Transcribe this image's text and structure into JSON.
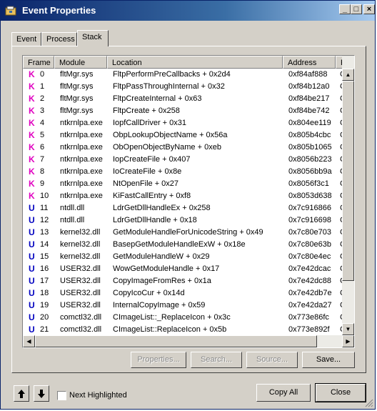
{
  "window": {
    "title": "Event Properties"
  },
  "tabs": [
    {
      "label": "Event",
      "active": false
    },
    {
      "label": "Process",
      "active": false
    },
    {
      "label": "Stack",
      "active": true
    }
  ],
  "columns": [
    "Frame",
    "Module",
    "Location",
    "Address",
    "P"
  ],
  "rows": [
    {
      "type": "K",
      "frame": "0",
      "module": "fltMgr.sys",
      "location": "FltpPerformPreCallbacks + 0x2d4",
      "address": "0xf84af888",
      "path": "C"
    },
    {
      "type": "K",
      "frame": "1",
      "module": "fltMgr.sys",
      "location": "FltpPassThroughInternal + 0x32",
      "address": "0xf84b12a0",
      "path": "C"
    },
    {
      "type": "K",
      "frame": "2",
      "module": "fltMgr.sys",
      "location": "FltpCreateInternal + 0x63",
      "address": "0xf84be217",
      "path": "C"
    },
    {
      "type": "K",
      "frame": "3",
      "module": "fltMgr.sys",
      "location": "FltpCreate + 0x258",
      "address": "0xf84be742",
      "path": "C"
    },
    {
      "type": "K",
      "frame": "4",
      "module": "ntkrnlpa.exe",
      "location": "IopfCallDriver + 0x31",
      "address": "0x804ee119",
      "path": "C"
    },
    {
      "type": "K",
      "frame": "5",
      "module": "ntkrnlpa.exe",
      "location": "ObpLookupObjectName + 0x56a",
      "address": "0x805b4cbc",
      "path": "C"
    },
    {
      "type": "K",
      "frame": "6",
      "module": "ntkrnlpa.exe",
      "location": "ObOpenObjectByName + 0xeb",
      "address": "0x805b1065",
      "path": "C"
    },
    {
      "type": "K",
      "frame": "7",
      "module": "ntkrnlpa.exe",
      "location": "IopCreateFile + 0x407",
      "address": "0x8056b223",
      "path": "C"
    },
    {
      "type": "K",
      "frame": "8",
      "module": "ntkrnlpa.exe",
      "location": "IoCreateFile + 0x8e",
      "address": "0x8056bb9a",
      "path": "C"
    },
    {
      "type": "K",
      "frame": "9",
      "module": "ntkrnlpa.exe",
      "location": "NtOpenFile + 0x27",
      "address": "0x8056f3c1",
      "path": "C"
    },
    {
      "type": "K",
      "frame": "10",
      "module": "ntkrnlpa.exe",
      "location": "KiFastCallEntry + 0xf8",
      "address": "0x8053d638",
      "path": "C"
    },
    {
      "type": "U",
      "frame": "11",
      "module": "ntdll.dll",
      "location": "LdrGetDllHandleEx + 0x258",
      "address": "0x7c916866",
      "path": "C"
    },
    {
      "type": "U",
      "frame": "12",
      "module": "ntdll.dll",
      "location": "LdrGetDllHandle + 0x18",
      "address": "0x7c916698",
      "path": "C"
    },
    {
      "type": "U",
      "frame": "13",
      "module": "kernel32.dll",
      "location": "GetModuleHandleForUnicodeString + 0x49",
      "address": "0x7c80e703",
      "path": "C"
    },
    {
      "type": "U",
      "frame": "14",
      "module": "kernel32.dll",
      "location": "BasepGetModuleHandleExW + 0x18e",
      "address": "0x7c80e63b",
      "path": "C"
    },
    {
      "type": "U",
      "frame": "15",
      "module": "kernel32.dll",
      "location": "GetModuleHandleW + 0x29",
      "address": "0x7c80e4ec",
      "path": "C"
    },
    {
      "type": "U",
      "frame": "16",
      "module": "USER32.dll",
      "location": "WowGetModuleHandle + 0x17",
      "address": "0x7e42dcac",
      "path": "C"
    },
    {
      "type": "U",
      "frame": "17",
      "module": "USER32.dll",
      "location": "CopyImageFromRes + 0x1a",
      "address": "0x7e42dc88",
      "path": "C"
    },
    {
      "type": "U",
      "frame": "18",
      "module": "USER32.dll",
      "location": "CopyIcoCur + 0x14d",
      "address": "0x7e42db7e",
      "path": "C"
    },
    {
      "type": "U",
      "frame": "19",
      "module": "USER32.dll",
      "location": "InternalCopyImage + 0x59",
      "address": "0x7e42da27",
      "path": "C"
    },
    {
      "type": "U",
      "frame": "20",
      "module": "comctl32.dll",
      "location": "CImageList::_ReplaceIcon + 0x3c",
      "address": "0x773e86fc",
      "path": "C"
    },
    {
      "type": "U",
      "frame": "21",
      "module": "comctl32.dll",
      "location": "CImageList::ReplaceIcon + 0x5b",
      "address": "0x773e892f",
      "path": "C"
    }
  ],
  "panel_buttons": {
    "properties": "Properties...",
    "search": "Search...",
    "source": "Source...",
    "save": "Save..."
  },
  "footer": {
    "next_highlighted": "Next Highlighted",
    "copy_all": "Copy All",
    "close": "Close"
  },
  "icons": {
    "kernel_frame": "K",
    "user_frame": "U",
    "up": "up-arrow-icon",
    "down": "down-arrow-icon"
  },
  "colors": {
    "kernel_glyph": "#e000c0",
    "user_glyph": "#0000c0",
    "titlebar": "#0a246a"
  }
}
